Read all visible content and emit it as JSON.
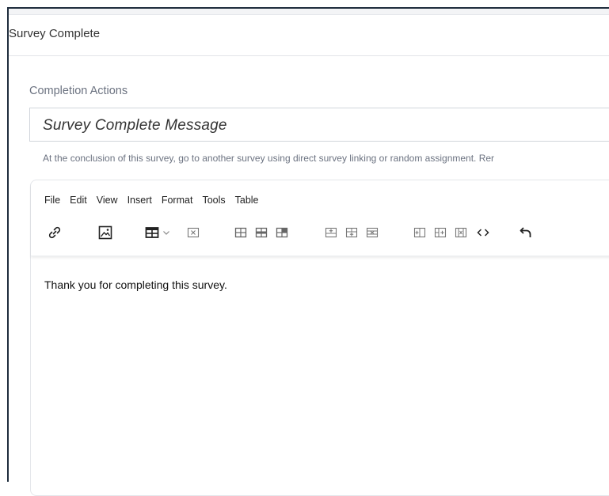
{
  "header": {
    "title": "Survey Complete"
  },
  "completion": {
    "section_label": "Completion Actions",
    "message_value": "Survey Complete Message",
    "help_text": "At the conclusion of this survey, go to another survey using direct survey linking or random assignment. Rer"
  },
  "editor": {
    "menu": [
      "File",
      "Edit",
      "View",
      "Insert",
      "Format",
      "Tools",
      "Table"
    ],
    "toolbar_icons": [
      "link-icon",
      "image-icon",
      "table-icon",
      "chevron-down-icon",
      "delete-table-icon",
      "table-properties-icon",
      "row-properties-icon",
      "cell-properties-icon",
      "insert-row-before-icon",
      "insert-row-after-icon",
      "delete-row-icon",
      "insert-column-before-icon",
      "insert-column-after-icon",
      "delete-column-icon",
      "source-code-icon",
      "undo-icon"
    ],
    "content_text": "Thank you for completing this survey."
  },
  "colors": {
    "frame_border": "#1f2d3d",
    "label_gray": "#6b7280",
    "icon_dark": "#222222"
  }
}
